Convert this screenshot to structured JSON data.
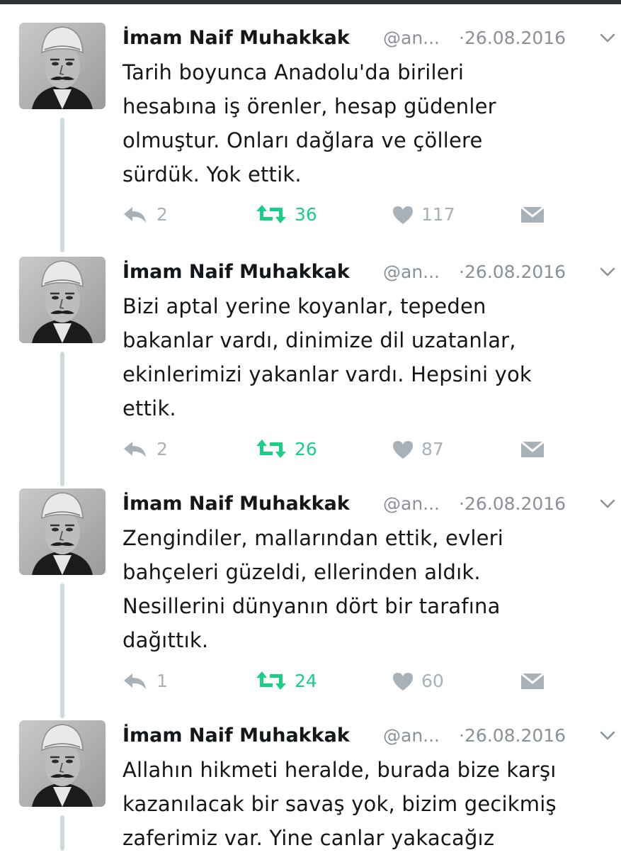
{
  "colors": {
    "retweet": "#19cf86",
    "muted": "#a8b0b8",
    "text": "#14171a",
    "thread_line": "#cfd9de"
  },
  "tweets": [
    {
      "name": "İmam Naif Muhakkak",
      "handle": "@an...",
      "date": "·26.08.2016",
      "text": "Tarih boyunca Anadolu'da birileri\nhesabına iş örenler, hesap güdenler\nolmuştur. Onları dağlara ve çöllere\nsürdük. Yok ettik.",
      "replies": "2",
      "retweets": "36",
      "likes": "117"
    },
    {
      "name": "İmam Naif Muhakkak",
      "handle": "@an...",
      "date": "·26.08.2016",
      "text": "Bizi aptal yerine koyanlar, tepeden\nbakanlar vardı, dinimize dil uzatanlar,\nekinlerimizi yakanlar vardı. Hepsini yok\nettik.",
      "replies": "2",
      "retweets": "26",
      "likes": "87"
    },
    {
      "name": "İmam Naif Muhakkak",
      "handle": "@an...",
      "date": "·26.08.2016",
      "text": "Zengindiler, mallarından ettik, evleri\nbahçeleri güzeldi, ellerinden aldık.\nNesillerini dünyanın dört bir tarafına\ndağıttık.",
      "replies": "1",
      "retweets": "24",
      "likes": "60"
    },
    {
      "name": "İmam Naif Muhakkak",
      "handle": "@an...",
      "date": "·26.08.2016",
      "text": "Allahın hikmeti heralde, burada bize karşı\nkazanılacak bir savaş yok, bizim gecikmiş\nzaferimiz var. Yine canlar yakacağız"
    }
  ]
}
